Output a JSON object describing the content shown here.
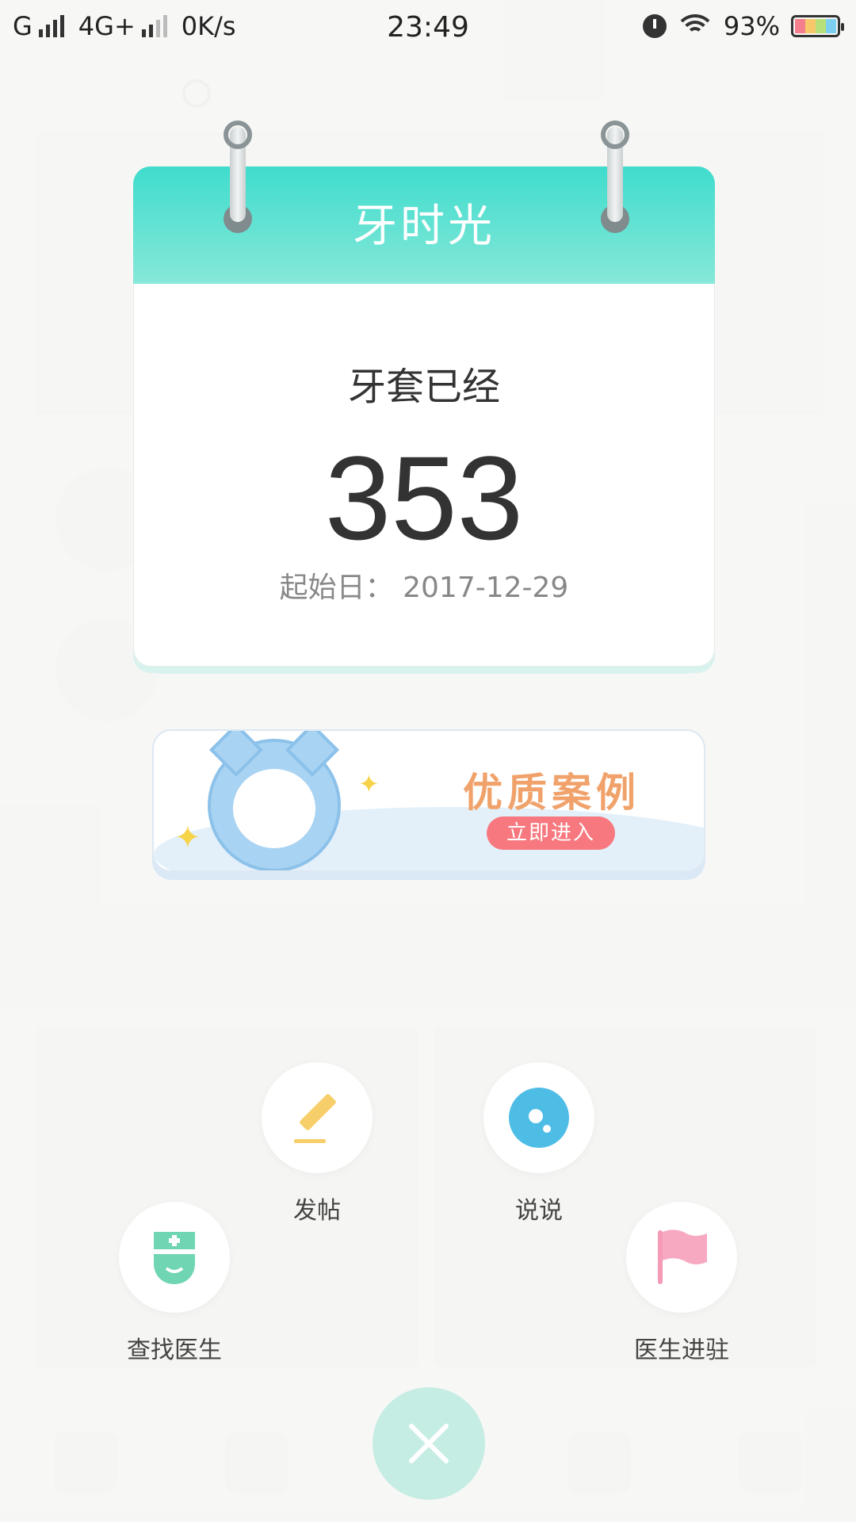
{
  "status_bar": {
    "carrier": "G",
    "network": "4G+",
    "speed": "0K/s",
    "time": "23:49",
    "battery": "93%"
  },
  "calendar": {
    "title": "牙时光",
    "label": "牙套已经",
    "days": "353",
    "start_date": "起始日：  2017-12-29"
  },
  "promo": {
    "title": "优质案例",
    "button": "立即进入"
  },
  "actions": {
    "post": "发帖",
    "say": "说说",
    "find_doctor": "查找医生",
    "doctor_join": "医生进驻"
  },
  "colors": {
    "accent": "#3fdccd",
    "promo_title": "#f0a26a",
    "promo_button": "#f7787e"
  }
}
